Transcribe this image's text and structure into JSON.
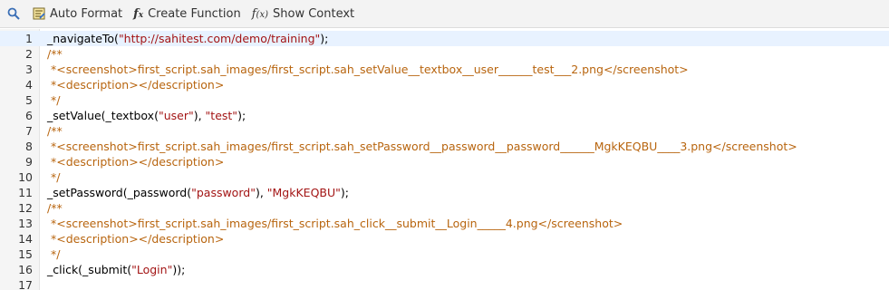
{
  "toolbar": {
    "search_icon": "magnifier-icon",
    "auto_format_label": "Auto Format",
    "create_function_label": "Create Function",
    "show_context_label": "Show Context"
  },
  "editor": {
    "lines": [
      {
        "num": "1",
        "segments": [
          {
            "t": "_navigateTo(",
            "c": "fn"
          },
          {
            "t": "\"http://sahitest.com/demo/training\"",
            "c": "str"
          },
          {
            "t": ");",
            "c": "punct"
          }
        ]
      },
      {
        "num": "2",
        "segments": [
          {
            "t": "/**",
            "c": "cmt"
          }
        ]
      },
      {
        "num": "3",
        "segments": [
          {
            "t": " *<screenshot>first_script.sah_images/first_script.sah_setValue__textbox__user______test___2.png</screenshot>",
            "c": "cmt"
          }
        ]
      },
      {
        "num": "4",
        "segments": [
          {
            "t": " *<description></description>",
            "c": "cmt"
          }
        ]
      },
      {
        "num": "5",
        "segments": [
          {
            "t": " */",
            "c": "cmt"
          }
        ]
      },
      {
        "num": "6",
        "segments": [
          {
            "t": "_setValue(_textbox(",
            "c": "fn"
          },
          {
            "t": "\"user\"",
            "c": "str"
          },
          {
            "t": "), ",
            "c": "punct"
          },
          {
            "t": "\"test\"",
            "c": "str"
          },
          {
            "t": ");",
            "c": "punct"
          }
        ]
      },
      {
        "num": "7",
        "segments": [
          {
            "t": "/**",
            "c": "cmt"
          }
        ]
      },
      {
        "num": "8",
        "segments": [
          {
            "t": " *<screenshot>first_script.sah_images/first_script.sah_setPassword__password__password______MgkKEQBU____3.png</screenshot>",
            "c": "cmt"
          }
        ]
      },
      {
        "num": "9",
        "segments": [
          {
            "t": " *<description></description>",
            "c": "cmt"
          }
        ]
      },
      {
        "num": "10",
        "segments": [
          {
            "t": " */",
            "c": "cmt"
          }
        ]
      },
      {
        "num": "11",
        "segments": [
          {
            "t": "_setPassword(_password(",
            "c": "fn"
          },
          {
            "t": "\"password\"",
            "c": "str"
          },
          {
            "t": "), ",
            "c": "punct"
          },
          {
            "t": "\"MgkKEQBU\"",
            "c": "str"
          },
          {
            "t": ");",
            "c": "punct"
          }
        ]
      },
      {
        "num": "12",
        "segments": [
          {
            "t": "/**",
            "c": "cmt"
          }
        ]
      },
      {
        "num": "13",
        "segments": [
          {
            "t": " *<screenshot>first_script.sah_images/first_script.sah_click__submit__Login_____4.png</screenshot>",
            "c": "cmt"
          }
        ]
      },
      {
        "num": "14",
        "segments": [
          {
            "t": " *<description></description>",
            "c": "cmt"
          }
        ]
      },
      {
        "num": "15",
        "segments": [
          {
            "t": " */",
            "c": "cmt"
          }
        ]
      },
      {
        "num": "16",
        "segments": [
          {
            "t": "_click(_submit(",
            "c": "fn"
          },
          {
            "t": "\"Login\"",
            "c": "str"
          },
          {
            "t": "));",
            "c": "punct"
          }
        ]
      },
      {
        "num": "17",
        "segments": []
      }
    ]
  },
  "colors": {
    "string": "#a31515",
    "comment": "#b8650f",
    "active_line": "#e8f2ff"
  }
}
